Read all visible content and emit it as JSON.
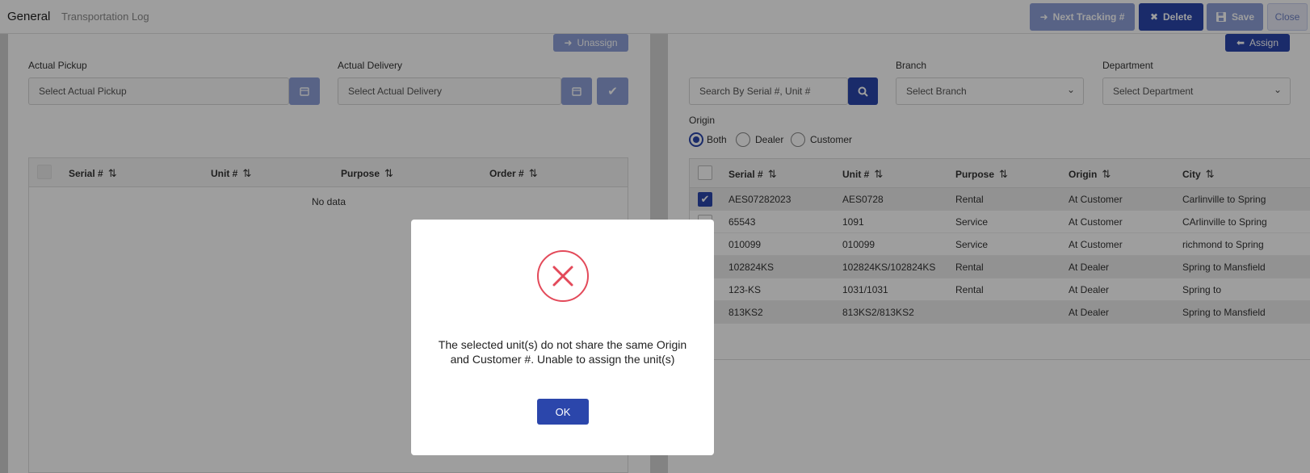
{
  "header": {
    "tab_general": "General",
    "tab_log": "Transportation Log",
    "next_tracking": "Next Tracking #",
    "delete": "Delete",
    "save": "Save",
    "close": "Close"
  },
  "left": {
    "unassign": "Unassign",
    "actual_pickup_label": "Actual Pickup",
    "actual_pickup_placeholder": "Select Actual Pickup",
    "actual_delivery_label": "Actual Delivery",
    "actual_delivery_placeholder": "Select Actual Delivery",
    "columns": [
      "Serial #",
      "Unit #",
      "Purpose",
      "Order #"
    ],
    "empty": "No data"
  },
  "right": {
    "assign": "Assign",
    "search_placeholder": "Search By Serial #, Unit #",
    "branch_label": "Branch",
    "branch_placeholder": "Select Branch",
    "department_label": "Department",
    "department_placeholder": "Select Department",
    "origin_label": "Origin",
    "origin_options": [
      "Both",
      "Dealer",
      "Customer"
    ],
    "origin_selected": "Both",
    "columns": [
      "Serial #",
      "Unit #",
      "Purpose",
      "Origin",
      "City"
    ],
    "rows": [
      [
        "AES07282023",
        "AES0728",
        "Rental",
        "At Customer",
        "Carlinville to Spring"
      ],
      [
        "65543",
        "1091",
        "Service",
        "At Customer",
        "CArlinville to Spring"
      ],
      [
        "010099",
        "010099",
        "Service",
        "At Customer",
        "richmond to Spring"
      ],
      [
        "102824KS",
        "102824KS/102824KS",
        "Rental",
        "At Dealer",
        "Spring to Mansfield"
      ],
      [
        "123-KS",
        "1031/1031",
        "Rental",
        "At Dealer",
        "Spring to"
      ],
      [
        "813KS2",
        "813KS2/813KS2",
        "",
        "At Dealer",
        "Spring to Mansfield"
      ]
    ]
  },
  "dialog": {
    "message": "The selected unit(s) do not share the same Origin and Customer #. Unable to assign the unit(s)",
    "ok": "OK"
  },
  "colors": {
    "primary": "#2b46ab",
    "primary_light": "#8ea0d8",
    "error": "#e34a5a"
  }
}
